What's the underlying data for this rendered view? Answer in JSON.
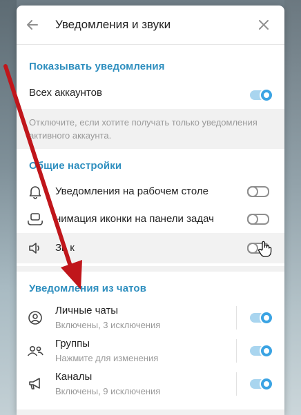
{
  "header": {
    "title": "Уведомления и звуки"
  },
  "section_show": {
    "heading": "Показывать уведомления",
    "all_accounts_label": "Всех аккаунтов",
    "all_accounts_on": true,
    "note": "Отключите, если хотите получать только уведомления активного аккаунта."
  },
  "section_general": {
    "heading": "Общие настройки",
    "items": [
      {
        "label": "Уведомления на рабочем столе",
        "icon": "bell-icon",
        "on": false
      },
      {
        "label": "нимация иконки на панели задач",
        "icon": "taskbar-icon",
        "on": false
      },
      {
        "label": "Зв к",
        "icon": "speaker-icon",
        "on": false
      }
    ]
  },
  "section_chats": {
    "heading": "Уведомления из чатов",
    "items": [
      {
        "label": "Личные чаты",
        "sub": "Включены, 3 исключения",
        "icon": "person-icon",
        "on": true
      },
      {
        "label": "Группы",
        "sub": "Нажмите для изменения",
        "icon": "group-icon",
        "on": true
      },
      {
        "label": "Каналы",
        "sub": "Включены, 9 исключения",
        "icon": "megaphone-icon",
        "on": true
      }
    ]
  },
  "colors": {
    "accent": "#3aa3e3",
    "heading": "#2f8fbf",
    "arrow": "#c0161b"
  }
}
